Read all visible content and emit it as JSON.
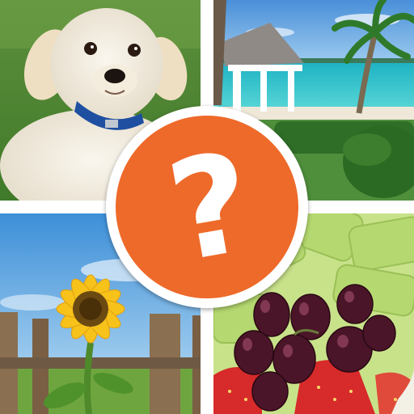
{
  "puzzle": {
    "hint_symbol": "?",
    "hint_color": "#EE6A2A",
    "tiles": [
      {
        "subject": "puppy-photo"
      },
      {
        "subject": "beach-gazebo-photo"
      },
      {
        "subject": "sunflower-photo"
      },
      {
        "subject": "fruit-photo"
      }
    ]
  }
}
